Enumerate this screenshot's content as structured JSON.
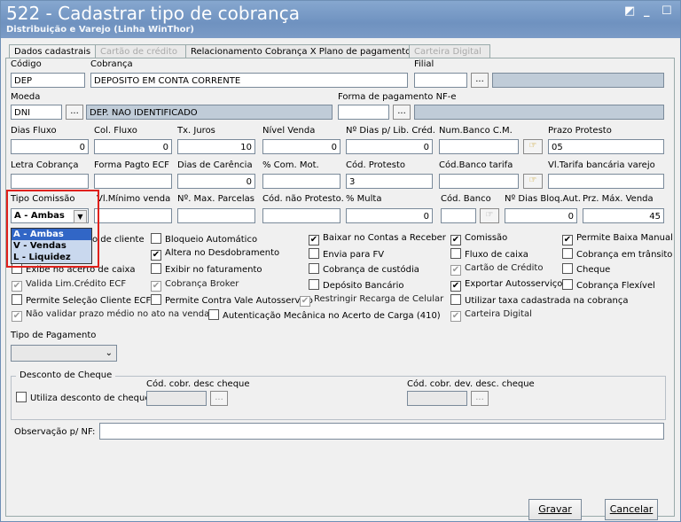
{
  "window": {
    "title": "522 - Cadastrar tipo de cobrança",
    "subtitle": "Distribuição e Varejo (Linha WinThor)",
    "controls": [
      "◩",
      "_",
      "☐",
      "✕"
    ]
  },
  "tabs": [
    {
      "label": "Dados cadastrais",
      "state": "active"
    },
    {
      "label": "Cartão de crédito",
      "state": "disabled"
    },
    {
      "label": "Relacionamento Cobrança X Plano de pagamento",
      "state": "normal"
    },
    {
      "label": "Carteira Digital",
      "state": "disabled"
    }
  ],
  "form": {
    "codigo": {
      "label": "Código",
      "value": "DEP"
    },
    "cobranca": {
      "label": "Cobrança",
      "value": "DEPOSITO EM CONTA CORRENTE"
    },
    "filial": {
      "label": "Filial",
      "value": ""
    },
    "moeda": {
      "label": "Moeda",
      "value": "DNI",
      "desc": "DEP. NAO IDENTIFICADO"
    },
    "forma_pgto_nfe": {
      "label": "Forma de pagamento NF-e",
      "value": ""
    },
    "dias_fluxo": {
      "label": "Dias Fluxo",
      "value": "0"
    },
    "col_fluxo": {
      "label": "Col. Fluxo",
      "value": "0"
    },
    "tx_juros": {
      "label": "Tx. Juros",
      "value": "10"
    },
    "nivel_venda": {
      "label": "Nível Venda",
      "value": "0"
    },
    "dias_lib_cred": {
      "label": "Nº Dias p/ Lib. Créd.",
      "value": "0"
    },
    "num_banco_cm": {
      "label": "Num.Banco C.M.",
      "value": ""
    },
    "prazo_protesto": {
      "label": "Prazo Protesto",
      "value": "05"
    },
    "letra_cobranca": {
      "label": "Letra Cobrança",
      "value": ""
    },
    "forma_pagto_ecf": {
      "label": "Forma Pagto ECF",
      "value": ""
    },
    "dias_carencia": {
      "label": "Dias de Carência",
      "value": "0"
    },
    "com_mot": {
      "label": "% Com. Mot.",
      "value": ""
    },
    "cod_protesto": {
      "label": "Cód. Protesto",
      "value": "3"
    },
    "cod_banco_tarifa": {
      "label": "Cód.Banco tarifa",
      "value": ""
    },
    "vl_tarifa": {
      "label": "Vl.Tarifa bancária varejo",
      "value": ""
    },
    "tipo_comissao": {
      "label": "Tipo Comissão",
      "value": "A - Ambas",
      "options": [
        "A - Ambas",
        "V - Vendas",
        "L - Liquidez"
      ]
    },
    "vl_min_venda": {
      "label": "Vl.Mínimo venda",
      "value": ""
    },
    "max_parcelas": {
      "label": "Nº. Max. Parcelas",
      "value": ""
    },
    "cod_nao_protesto": {
      "label": "Cód. não Protesto.",
      "value": ""
    },
    "multa": {
      "label": "% Multa",
      "value": "0"
    },
    "cod_banco": {
      "label": "Cód. Banco",
      "value": ""
    },
    "dias_bloq": {
      "label": "Nº Dias Bloq.Aut.",
      "value": "0"
    },
    "prz_max_venda": {
      "label": "Prz. Máx. Venda",
      "value": "45"
    },
    "tipo_pagamento": {
      "label": "Tipo de Pagamento",
      "value": ""
    },
    "desconto_cheque": {
      "label": "Desconto de Cheque",
      "utiliza": "Utiliza desconto de cheque",
      "cod_desc": "Cód. cobr. desc cheque",
      "cod_dev": "Cód. cobr. dev. desc. cheque"
    },
    "observacao": {
      "label": "Observação p/ NF:",
      "value": ""
    }
  },
  "checkboxes": {
    "c0": {
      "label": "o de cliente",
      "checked": false
    },
    "c1": {
      "label": "Bloqueio Automático",
      "checked": false
    },
    "c2": {
      "label": "Baixar no Contas a Receber",
      "checked": true
    },
    "c3": {
      "label": "Comissão",
      "checked": true
    },
    "c4": {
      "label": "Permite Baixa Manual",
      "checked": true
    },
    "c5": {
      "label": "Altera no Desdobramento",
      "checked": true
    },
    "c6": {
      "label": "Envia para FV",
      "checked": false
    },
    "c7": {
      "label": "Fluxo de caixa",
      "checked": false
    },
    "c8": {
      "label": "Cobrança em trânsito",
      "checked": false
    },
    "c9": {
      "label": "Exibe no acerto de caixa",
      "checked": false
    },
    "c10": {
      "label": "Exibir no faturamento",
      "checked": false
    },
    "c11": {
      "label": "Cobrança de custódia",
      "checked": false
    },
    "c12": {
      "label": "Cartão de Crédito",
      "checked": true
    },
    "c13": {
      "label": "Cheque",
      "checked": false
    },
    "c14": {
      "label": "Valida Lim.Crédito ECF",
      "checked": true
    },
    "c15": {
      "label": "Cobrança Broker",
      "checked": true
    },
    "c16": {
      "label": "Depósito Bancário",
      "checked": false
    },
    "c17": {
      "label": "Exportar Autosserviço",
      "checked": true
    },
    "c18": {
      "label": "Cobrança Flexível",
      "checked": false
    },
    "c19": {
      "label": "Permite Seleção Cliente ECF",
      "checked": false
    },
    "c20": {
      "label": "Permite Contra Vale Autosserviço",
      "checked": false
    },
    "c21": {
      "label": "Restringir Recarga de Celular",
      "checked": true
    },
    "c22": {
      "label": "Utilizar taxa cadastrada na cobrança",
      "checked": false
    },
    "c23": {
      "label": "Não validar prazo médio no ato na venda",
      "checked": true
    },
    "c24": {
      "label": "Autenticação Mecânica no Acerto de Carga (410)",
      "checked": false
    },
    "c25": {
      "label": "Carteira Digital",
      "checked": true
    }
  },
  "buttons": {
    "gravar": "Gravar",
    "cancelar": "Cancelar",
    "ellipsis": "..."
  },
  "colors": {
    "title_bar": "#7b9bc6",
    "highlight": "#e0201c",
    "selection": "#3166c6"
  }
}
